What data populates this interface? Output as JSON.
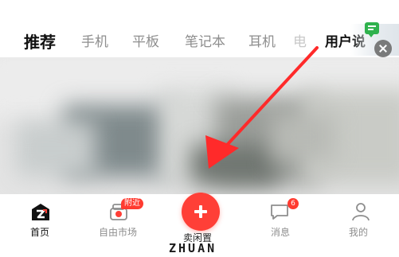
{
  "top_tabs": {
    "items": [
      {
        "label": "推荐",
        "active": true
      },
      {
        "label": "手机",
        "active": false
      },
      {
        "label": "平板",
        "active": false
      },
      {
        "label": "笔记本",
        "active": false
      },
      {
        "label": "耳机",
        "active": false
      },
      {
        "label": "电",
        "active": false
      },
      {
        "label": "用户说",
        "active": false
      }
    ],
    "icons": [
      "message-icon",
      "close-icon"
    ]
  },
  "bottom_nav": {
    "items": [
      {
        "label": "首页",
        "icon": "home-icon",
        "active": true
      },
      {
        "label": "自由市场",
        "icon": "market-icon",
        "badge": "附近"
      },
      {
        "label": "卖闲置",
        "icon": "plus-icon"
      },
      {
        "label": "消息",
        "icon": "message-icon",
        "badge": "6"
      },
      {
        "label": "我的",
        "icon": "profile-icon"
      }
    ]
  },
  "watermark": "ZHUAN",
  "colors": {
    "accent": "#ff3f37",
    "badge": "#ff3b30",
    "message_green": "#2fb24d",
    "active_text": "#111111",
    "inactive_text": "#8e8e8e"
  }
}
